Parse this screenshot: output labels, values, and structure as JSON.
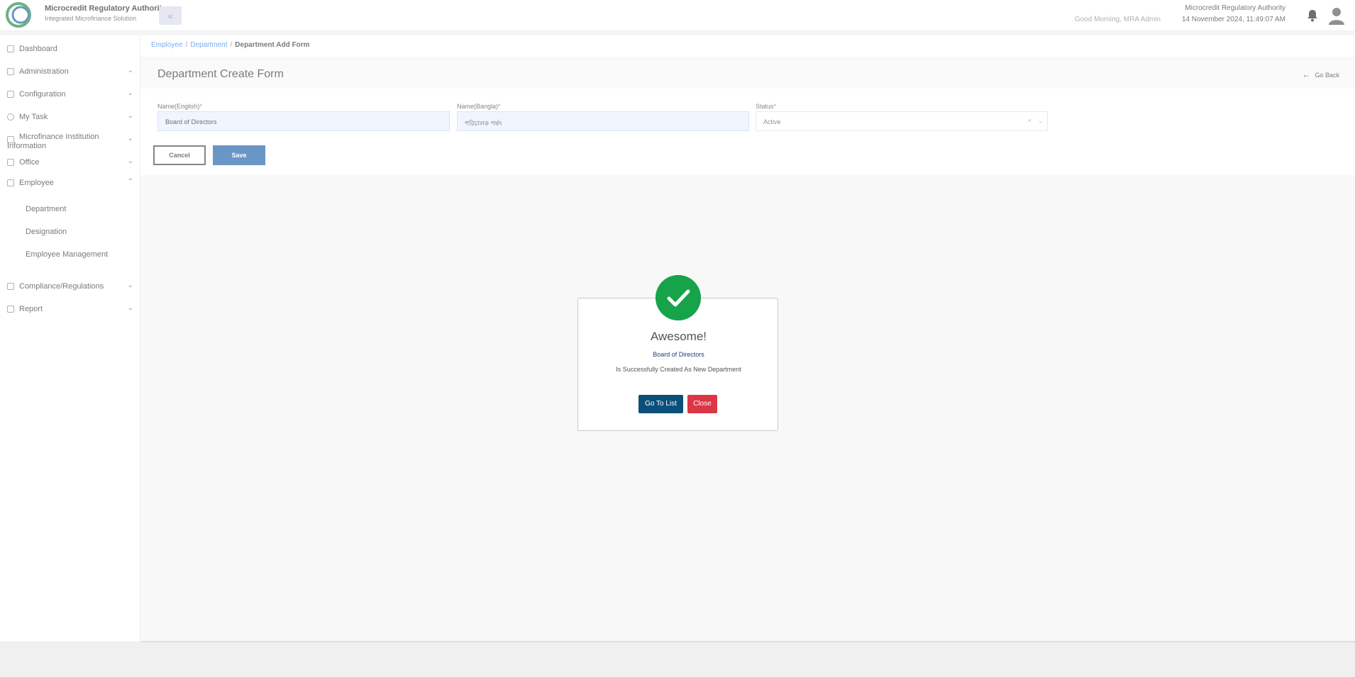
{
  "header": {
    "brand_title": "Microcredit Regulatory Authority",
    "brand_subtitle": "Integrated Microfinance Solution",
    "greeting": "Good Morning, MRA Admin",
    "org_name": "Microcredit Regulatory Authority",
    "datetime": "14 November 2024, 11:49:07 AM"
  },
  "sidebar": {
    "items": [
      {
        "label": "Dashboard"
      },
      {
        "label": "Administration"
      },
      {
        "label": "Configuration"
      },
      {
        "label": "My Task"
      },
      {
        "label": "Microfinance Institution Information"
      },
      {
        "label": "Office"
      },
      {
        "label": "Employee"
      },
      {
        "label": "Compliance/Regulations"
      },
      {
        "label": "Report"
      }
    ],
    "employee_sub": [
      "Department",
      "Designation",
      "Employee Management"
    ]
  },
  "breadcrumb": {
    "items": [
      "Employee",
      "Department"
    ],
    "current": "Department Add Form"
  },
  "form": {
    "title": "Department Create Form",
    "go_back": "Go Back",
    "name_en_label": "Name(English)",
    "name_en_value": "Board of Directors",
    "name_bn_label": "Name(Bangla)",
    "name_bn_value": "পরিচালক পর্ষদ",
    "status_label": "Status",
    "status_value": "Active",
    "cancel": "Cancel",
    "save": "Save"
  },
  "modal": {
    "title": "Awesome!",
    "name": "Board of Directors",
    "message": "Is Successfully Created As New Department",
    "go_to_list": "Go To List",
    "close": "Close"
  },
  "colors": {
    "primary": "#1a5faa",
    "success": "#16a34a",
    "danger": "#dc3545",
    "link": "#2f80ed"
  }
}
